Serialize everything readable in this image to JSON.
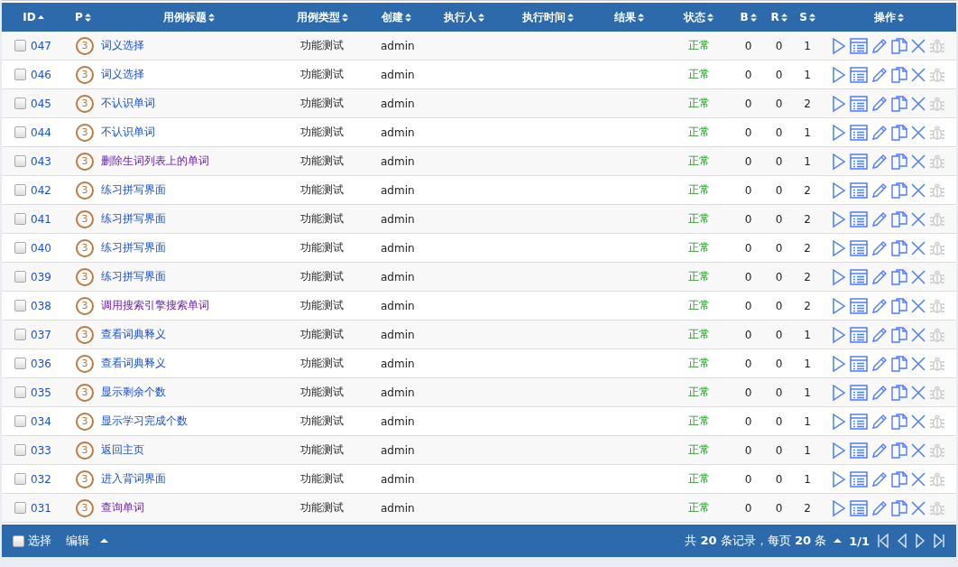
{
  "columns": [
    {
      "label": "ID",
      "sorted": true
    },
    {
      "label": "P",
      "sorted": false
    },
    {
      "label": "用例标题",
      "sorted": false
    },
    {
      "label": "用例类型",
      "sorted": false
    },
    {
      "label": "创建",
      "sorted": false
    },
    {
      "label": "执行人",
      "sorted": false
    },
    {
      "label": "执行时间",
      "sorted": false
    },
    {
      "label": "结果",
      "sorted": false
    },
    {
      "label": "状态",
      "sorted": false
    },
    {
      "label": "B",
      "sorted": false
    },
    {
      "label": "R",
      "sorted": false
    },
    {
      "label": "S",
      "sorted": false
    },
    {
      "label": "操作",
      "sorted": false
    }
  ],
  "rows": [
    {
      "checked": false,
      "id": "047",
      "priority": "3",
      "title": "词义选择",
      "visited": false,
      "type": "功能测试",
      "creator": "admin",
      "status": "正常",
      "b": "0",
      "r": "0",
      "s": "1"
    },
    {
      "checked": false,
      "id": "046",
      "priority": "3",
      "title": "词义选择",
      "visited": false,
      "type": "功能测试",
      "creator": "admin",
      "status": "正常",
      "b": "0",
      "r": "0",
      "s": "1"
    },
    {
      "checked": false,
      "id": "045",
      "priority": "3",
      "title": "不认识单词",
      "visited": false,
      "type": "功能测试",
      "creator": "admin",
      "status": "正常",
      "b": "0",
      "r": "0",
      "s": "2"
    },
    {
      "checked": false,
      "id": "044",
      "priority": "3",
      "title": "不认识单词",
      "visited": false,
      "type": "功能测试",
      "creator": "admin",
      "status": "正常",
      "b": "0",
      "r": "0",
      "s": "1"
    },
    {
      "checked": false,
      "id": "043",
      "priority": "3",
      "title": "删除生词列表上的单词",
      "visited": true,
      "type": "功能测试",
      "creator": "admin",
      "status": "正常",
      "b": "0",
      "r": "0",
      "s": "1"
    },
    {
      "checked": false,
      "id": "042",
      "priority": "3",
      "title": "练习拼写界面",
      "visited": false,
      "type": "功能测试",
      "creator": "admin",
      "status": "正常",
      "b": "0",
      "r": "0",
      "s": "2"
    },
    {
      "checked": false,
      "id": "041",
      "priority": "3",
      "title": "练习拼写界面",
      "visited": false,
      "type": "功能测试",
      "creator": "admin",
      "status": "正常",
      "b": "0",
      "r": "0",
      "s": "2"
    },
    {
      "checked": false,
      "id": "040",
      "priority": "3",
      "title": "练习拼写界面",
      "visited": false,
      "type": "功能测试",
      "creator": "admin",
      "status": "正常",
      "b": "0",
      "r": "0",
      "s": "2"
    },
    {
      "checked": false,
      "id": "039",
      "priority": "3",
      "title": "练习拼写界面",
      "visited": false,
      "type": "功能测试",
      "creator": "admin",
      "status": "正常",
      "b": "0",
      "r": "0",
      "s": "2"
    },
    {
      "checked": false,
      "id": "038",
      "priority": "3",
      "title": "调用搜索引擎搜索单词",
      "visited": true,
      "type": "功能测试",
      "creator": "admin",
      "status": "正常",
      "b": "0",
      "r": "0",
      "s": "2"
    },
    {
      "checked": false,
      "id": "037",
      "priority": "3",
      "title": "查看词典释义",
      "visited": false,
      "type": "功能测试",
      "creator": "admin",
      "status": "正常",
      "b": "0",
      "r": "0",
      "s": "1"
    },
    {
      "checked": false,
      "id": "036",
      "priority": "3",
      "title": "查看词典释义",
      "visited": false,
      "type": "功能测试",
      "creator": "admin",
      "status": "正常",
      "b": "0",
      "r": "0",
      "s": "1"
    },
    {
      "checked": false,
      "id": "035",
      "priority": "3",
      "title": "显示剩余个数",
      "visited": false,
      "type": "功能测试",
      "creator": "admin",
      "status": "正常",
      "b": "0",
      "r": "0",
      "s": "1"
    },
    {
      "checked": false,
      "id": "034",
      "priority": "3",
      "title": "显示学习完成个数",
      "visited": false,
      "type": "功能测试",
      "creator": "admin",
      "status": "正常",
      "b": "0",
      "r": "0",
      "s": "1"
    },
    {
      "checked": false,
      "id": "033",
      "priority": "3",
      "title": "返回主页",
      "visited": false,
      "type": "功能测试",
      "creator": "admin",
      "status": "正常",
      "b": "0",
      "r": "0",
      "s": "1"
    },
    {
      "checked": false,
      "id": "032",
      "priority": "3",
      "title": "进入背词界面",
      "visited": false,
      "type": "功能测试",
      "creator": "admin",
      "status": "正常",
      "b": "0",
      "r": "0",
      "s": "1"
    },
    {
      "checked": false,
      "id": "031",
      "priority": "3",
      "title": "查询单词",
      "visited": true,
      "type": "功能测试",
      "creator": "admin",
      "status": "正常",
      "b": "0",
      "r": "0",
      "s": "2"
    }
  ],
  "footer": {
    "select_all": {
      "label": "选择",
      "checked": false
    },
    "edit_label": "编辑",
    "summary": "共 **20** 条记录，每页 **20** 条",
    "page": "1/1"
  }
}
